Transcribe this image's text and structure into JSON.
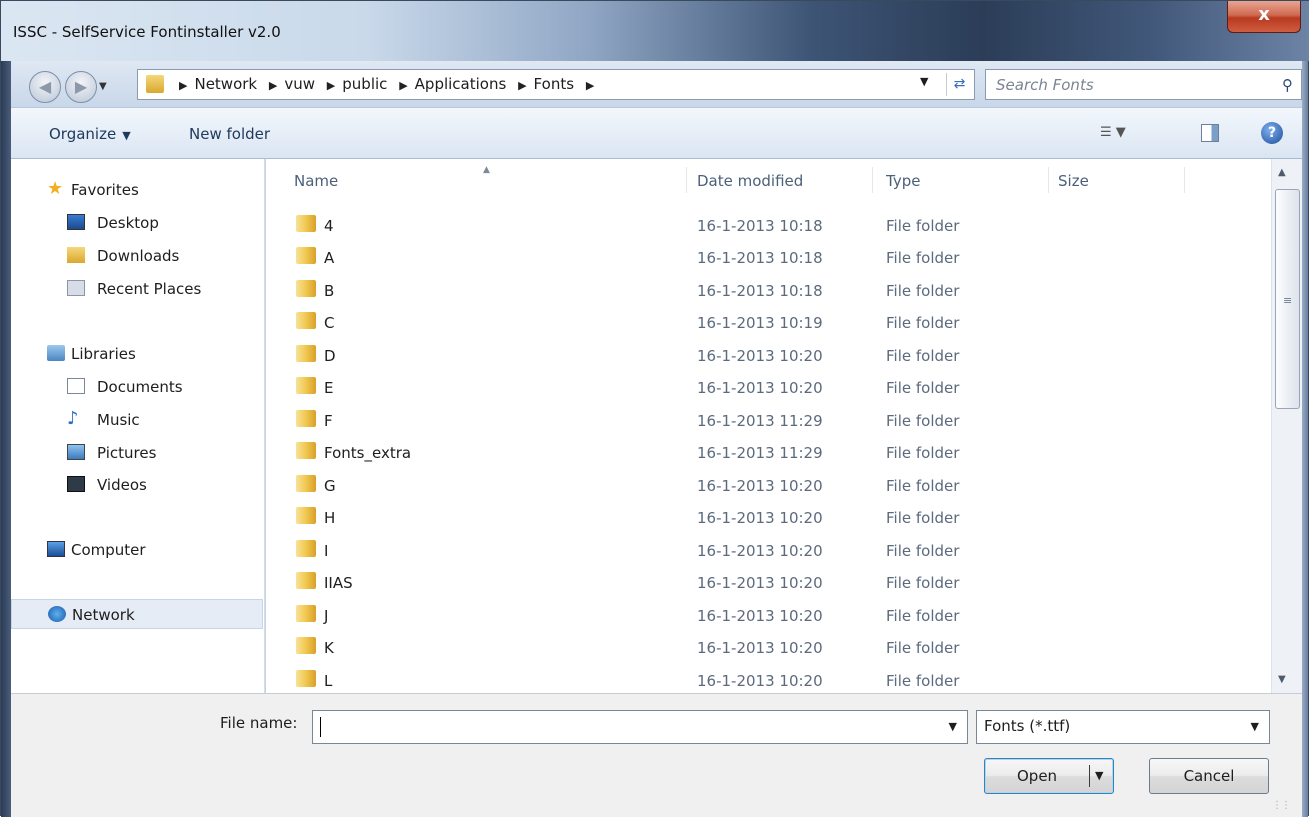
{
  "window": {
    "title": "ISSC - SelfService Fontinstaller v2.0",
    "close_glyph": "x"
  },
  "address": {
    "crumbs": [
      "Network",
      "vuw",
      "public",
      "Applications",
      "Fonts"
    ],
    "search_placeholder": "Search Fonts"
  },
  "toolbar": {
    "organize_label": "Organize",
    "new_folder_label": "New folder"
  },
  "nav": {
    "favorites": "Favorites",
    "desktop": "Desktop",
    "downloads": "Downloads",
    "recent_places": "Recent Places",
    "libraries": "Libraries",
    "documents": "Documents",
    "music": "Music",
    "pictures": "Pictures",
    "videos": "Videos",
    "computer": "Computer",
    "network": "Network"
  },
  "columns": {
    "name": "Name",
    "date": "Date modified",
    "type": "Type",
    "size": "Size"
  },
  "rows": [
    {
      "name": "4",
      "date": "16-1-2013 10:18",
      "type": "File folder"
    },
    {
      "name": "A",
      "date": "16-1-2013 10:18",
      "type": "File folder"
    },
    {
      "name": "B",
      "date": "16-1-2013 10:18",
      "type": "File folder"
    },
    {
      "name": "C",
      "date": "16-1-2013 10:19",
      "type": "File folder"
    },
    {
      "name": "D",
      "date": "16-1-2013 10:20",
      "type": "File folder"
    },
    {
      "name": "E",
      "date": "16-1-2013 10:20",
      "type": "File folder"
    },
    {
      "name": "F",
      "date": "16-1-2013 11:29",
      "type": "File folder"
    },
    {
      "name": "Fonts_extra",
      "date": "16-1-2013 11:29",
      "type": "File folder"
    },
    {
      "name": "G",
      "date": "16-1-2013 10:20",
      "type": "File folder"
    },
    {
      "name": "H",
      "date": "16-1-2013 10:20",
      "type": "File folder"
    },
    {
      "name": "I",
      "date": "16-1-2013 10:20",
      "type": "File folder"
    },
    {
      "name": "IIAS",
      "date": "16-1-2013 10:20",
      "type": "File folder"
    },
    {
      "name": "J",
      "date": "16-1-2013 10:20",
      "type": "File folder"
    },
    {
      "name": "K",
      "date": "16-1-2013 10:20",
      "type": "File folder"
    },
    {
      "name": "L",
      "date": "16-1-2013 10:20",
      "type": "File folder"
    }
  ],
  "footer": {
    "file_name_label": "File name:",
    "file_name_value": "",
    "filter_value": "Fonts (*.ttf)",
    "open_label": "Open",
    "cancel_label": "Cancel"
  }
}
